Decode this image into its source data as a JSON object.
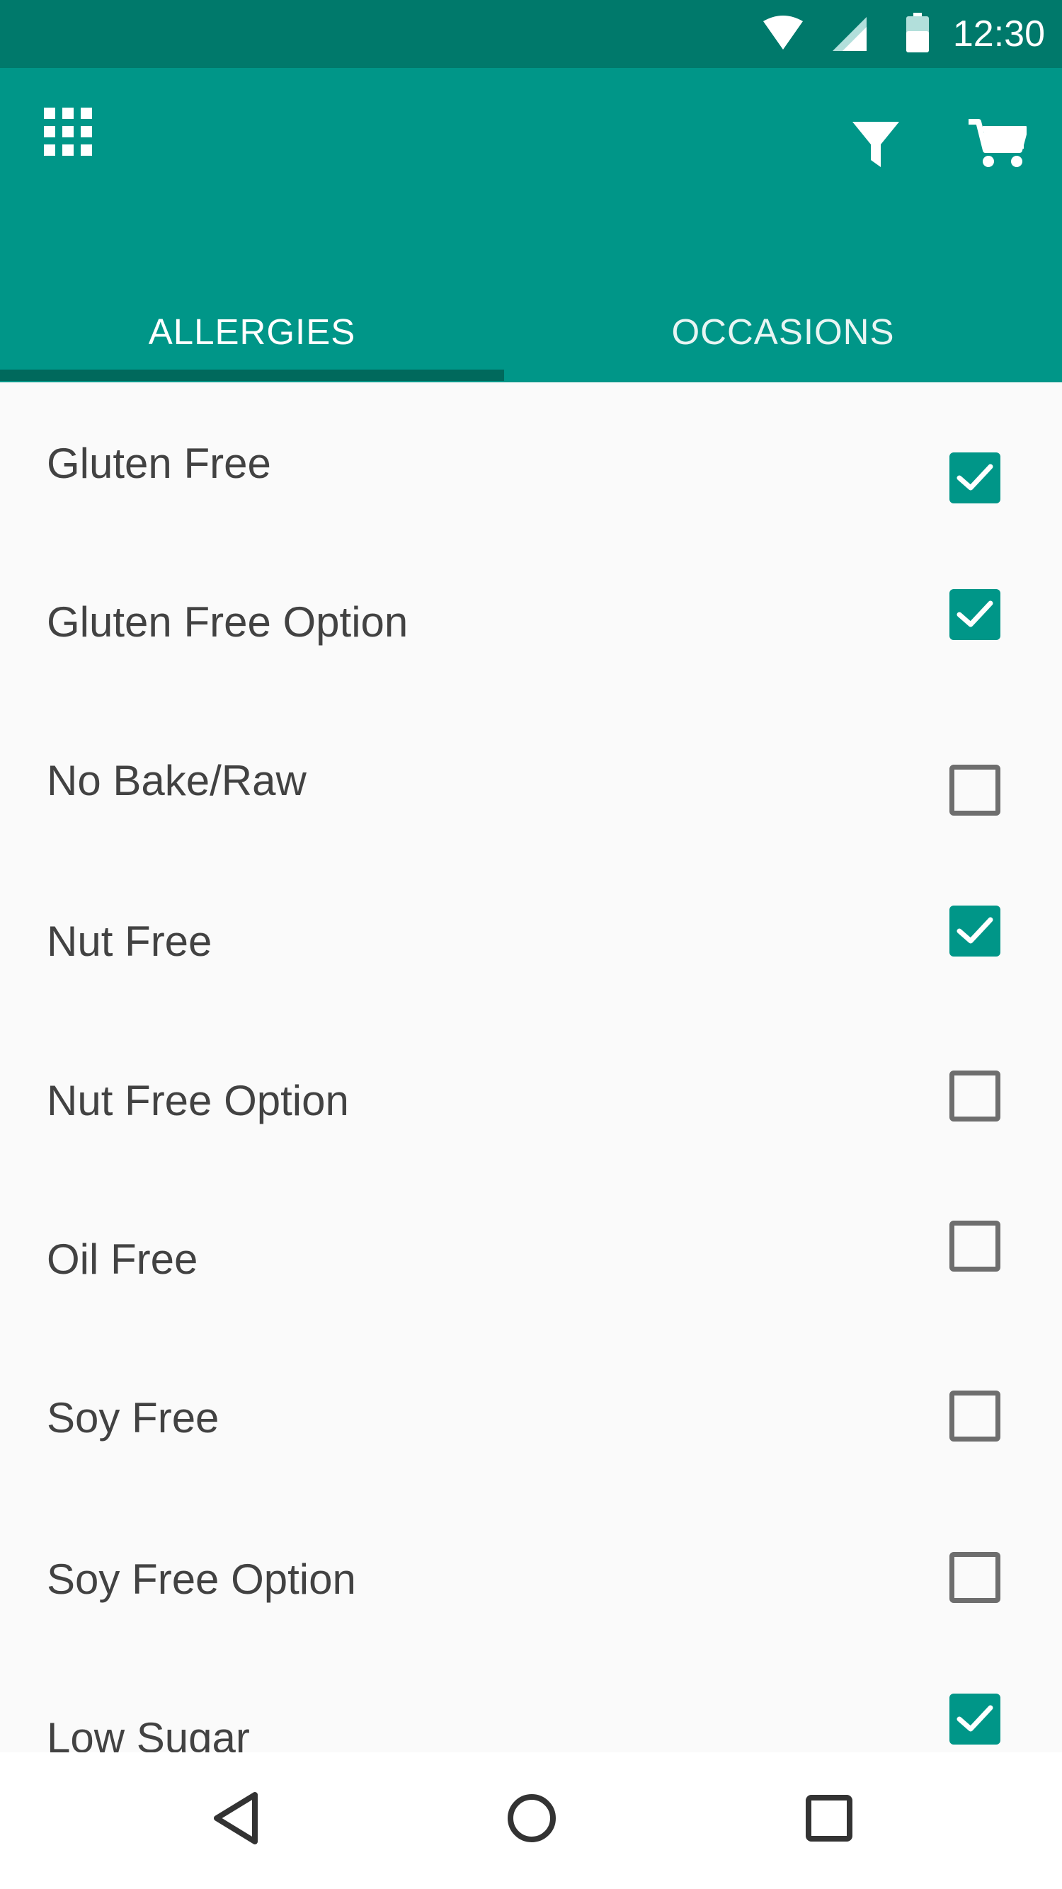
{
  "status_bar": {
    "time": "12:30",
    "icons": [
      "wifi-icon",
      "signal-icon",
      "battery-icon"
    ]
  },
  "app_bar": {
    "left_icon": "apps-grid-icon",
    "right_icons": [
      "filter-icon",
      "cart-icon"
    ],
    "tabs": [
      {
        "label": "ALLERGIES",
        "selected": true
      },
      {
        "label": "OCCASIONS",
        "selected": false
      }
    ]
  },
  "colors": {
    "primary": "#009688",
    "primary_dark": "#00796b",
    "indicator": "#00695c",
    "text": "#424242",
    "unchecked": "#6e6e6e"
  },
  "filters": [
    {
      "label": "Gluten Free",
      "checked": true
    },
    {
      "label": "Gluten Free Option",
      "checked": true
    },
    {
      "label": "No Bake/Raw",
      "checked": false
    },
    {
      "label": "Nut Free",
      "checked": true
    },
    {
      "label": "Nut Free Option",
      "checked": false
    },
    {
      "label": "Oil Free",
      "checked": false
    },
    {
      "label": "Soy Free",
      "checked": false
    },
    {
      "label": "Soy Free Option",
      "checked": false
    },
    {
      "label": "Low Sugar",
      "checked": true
    }
  ],
  "nav_bar": {
    "buttons": [
      "back-icon",
      "home-icon",
      "recents-icon"
    ]
  }
}
